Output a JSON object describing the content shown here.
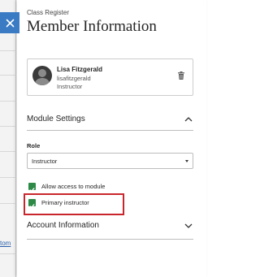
{
  "panel": {
    "breadcrumb": "Class Register",
    "title": "Member Information",
    "close_icon": "close-icon"
  },
  "member": {
    "name": "Lisa Fitzgerald",
    "username": "lisafitzgerald",
    "role": "Instructor",
    "avatar_icon": "avatar-placeholder-icon",
    "delete_icon": "trash-icon"
  },
  "module_settings": {
    "title": "Module Settings",
    "expanded": true,
    "role_label": "Role",
    "role_value": "Instructor",
    "options": [
      {
        "label": "Allow access to module",
        "checked": true
      },
      {
        "label": "Primary instructor",
        "checked": true,
        "highlighted": true
      }
    ]
  },
  "account_information": {
    "title": "Account Information",
    "expanded": false
  },
  "background": {
    "partial_link_text": "tom"
  },
  "colors": {
    "accent_blue": "#3a7bc4",
    "checkbox_green": "#2c8a46",
    "highlight_red": "#c8262c"
  }
}
